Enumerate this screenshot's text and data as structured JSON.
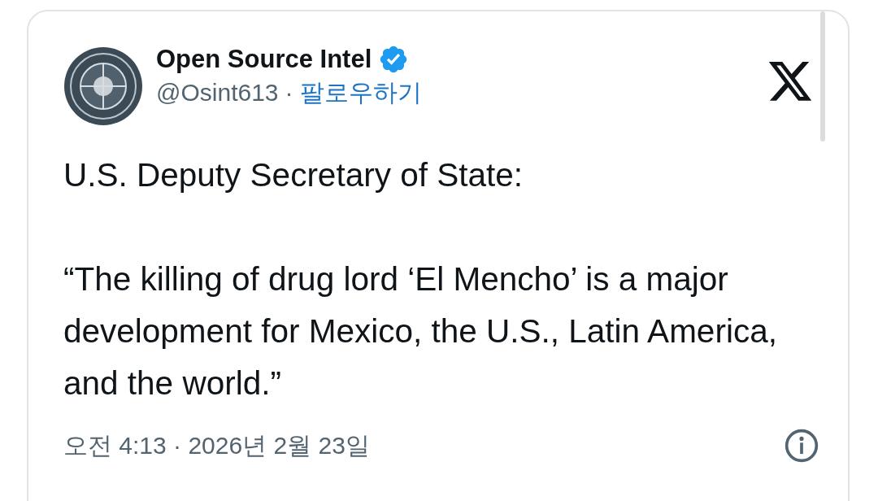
{
  "author": {
    "name": "Open Source Intel",
    "verified": true,
    "handle": "@Osint613",
    "separator": "·",
    "follow_link": "팔로우하기"
  },
  "tweet": {
    "paragraphs": [
      "U.S. Deputy Secretary of State:",
      "“The killing of drug lord ‘El Mencho’ is a major development for Mexico, the U.S., Latin America, and the world.”"
    ]
  },
  "footer": {
    "timestamp": "오전 4:13 · 2026년 2월 23일"
  }
}
